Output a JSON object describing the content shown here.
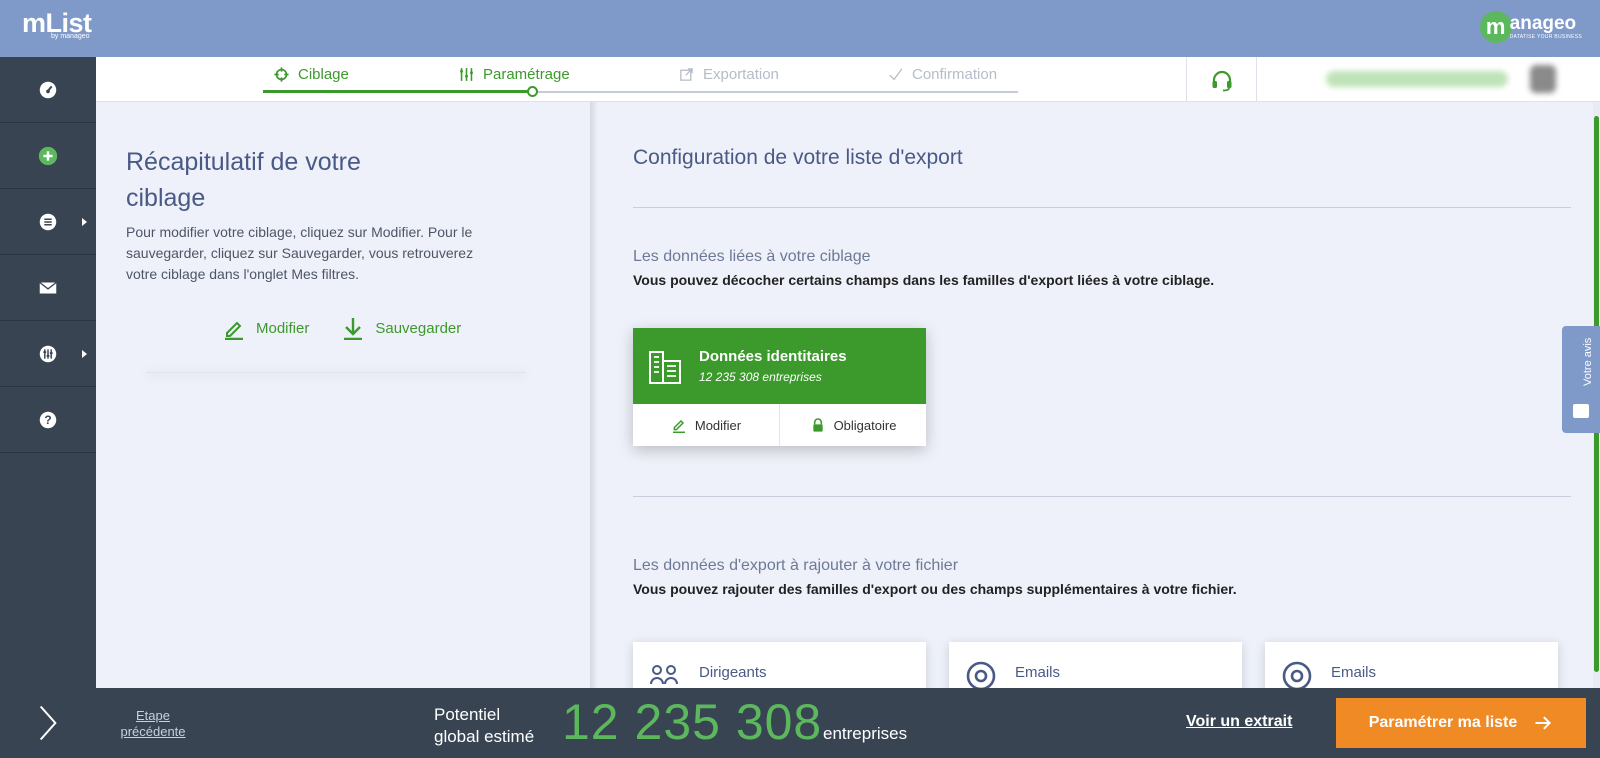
{
  "app": {
    "logo_main": "mList",
    "logo_sub": "by manageo",
    "brand_initial": "m",
    "brand_name": "anageo",
    "brand_tagline": "DATATISE YOUR BUSINESS"
  },
  "sidebar": {
    "items": [
      {
        "icon": "dashboard-icon",
        "has_submenu": false
      },
      {
        "icon": "add-icon",
        "has_submenu": false,
        "active": true
      },
      {
        "icon": "list-icon",
        "has_submenu": true
      },
      {
        "icon": "mail-icon",
        "has_submenu": false
      },
      {
        "icon": "settings-icon",
        "has_submenu": true
      },
      {
        "icon": "help-icon",
        "has_submenu": false
      }
    ],
    "next_icon": "chevron-right-icon"
  },
  "stepper": {
    "steps": [
      {
        "label": "Ciblage",
        "state": "done",
        "icon": "target-icon"
      },
      {
        "label": "Paramétrage",
        "state": "current",
        "icon": "sliders-icon"
      },
      {
        "label": "Exportation",
        "state": "todo",
        "icon": "export-icon"
      },
      {
        "label": "Confirmation",
        "state": "todo",
        "icon": "check-icon"
      }
    ]
  },
  "header": {
    "support_icon": "headset-icon"
  },
  "left": {
    "title": "Récapitulatif de votre ciblage",
    "description": "Pour modifier votre ciblage, cliquez sur Modifier. Pour le sauvegarder, cliquez sur Sauvegarder, vous retrouverez votre ciblage dans l'onglet Mes filtres.",
    "modify_label": "Modifier",
    "save_label": "Sauvegarder"
  },
  "main": {
    "title": "Configuration de votre liste d'export",
    "section1": {
      "title": "Les données liées à votre ciblage",
      "subtitle": "Vous pouvez décocher certains champs dans les familles d'export liées à votre ciblage."
    },
    "identity_card": {
      "title": "Données identitaires",
      "count": "12 235 308 entreprises",
      "modify_label": "Modifier",
      "mandatory_label": "Obligatoire"
    },
    "section2": {
      "title": "Les données d'export à rajouter à votre fichier",
      "subtitle": "Vous pouvez rajouter des familles d'export ou des champs supplémentaires à votre fichier."
    },
    "export_cards": [
      {
        "label": "Dirigeants",
        "icon": "people-icon"
      },
      {
        "label": "Emails",
        "icon": "at-icon"
      },
      {
        "label": "Emails",
        "icon": "at-icon"
      }
    ]
  },
  "feedback": {
    "label": "Votre avis"
  },
  "footer": {
    "prev_label": "Etape précédente",
    "potential_label": "Potentiel global estimé",
    "potential_value": "12 235 308",
    "potential_unit": "entreprises",
    "sample_label": "Voir un extrait",
    "cta_label": "Paramétrer ma liste"
  },
  "colors": {
    "accent_green": "#3c9a2c",
    "header_blue": "#7f99c9",
    "sidebar_dark": "#394453",
    "cta_orange": "#f08a25"
  }
}
